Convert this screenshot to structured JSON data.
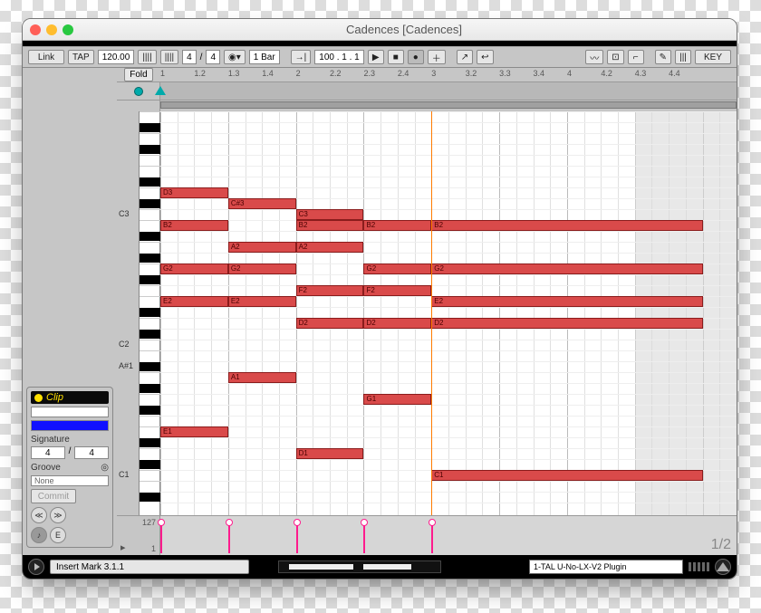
{
  "window": {
    "title": "Cadences  [Cadences]"
  },
  "toolbar": {
    "link": "Link",
    "tap": "TAP",
    "tempo": "120.00",
    "sig_num": "4",
    "sig_den": "4",
    "quantize": "1 Bar",
    "position": "100 .  1 .  1",
    "key": "KEY"
  },
  "timeline": {
    "fold": "Fold",
    "ticks": [
      "1",
      "1.2",
      "1.3",
      "1.4",
      "2",
      "2.2",
      "2.3",
      "2.4",
      "3",
      "3.2",
      "3.3",
      "3.4",
      "4",
      "4.2",
      "4.3",
      "4.4"
    ]
  },
  "clip_panel": {
    "header": "Clip",
    "signature_label": "Signature",
    "sig_num": "4",
    "sig_den": "4",
    "groove_label": "Groove",
    "groove_value": "None",
    "commit": "Commit"
  },
  "key_labels": [
    {
      "name": "C3",
      "row": 9
    },
    {
      "name": "C2",
      "row": 21
    },
    {
      "name": "A#1",
      "row": 23
    },
    {
      "name": "C1",
      "row": 33
    }
  ],
  "notes": [
    {
      "label": "D3",
      "row": 7,
      "start": 0,
      "len": 4
    },
    {
      "label": "C#3",
      "row": 8,
      "start": 4,
      "len": 4
    },
    {
      "label": "C3",
      "row": 9,
      "start": 8,
      "len": 4
    },
    {
      "label": "B2",
      "row": 10,
      "start": 0,
      "len": 4
    },
    {
      "label": "B2",
      "row": 10,
      "start": 8,
      "len": 4
    },
    {
      "label": "B2",
      "row": 10,
      "start": 12,
      "len": 4
    },
    {
      "label": "B2",
      "row": 10,
      "start": 16,
      "len": 16
    },
    {
      "label": "A2",
      "row": 12,
      "start": 4,
      "len": 4
    },
    {
      "label": "A2",
      "row": 12,
      "start": 8,
      "len": 4
    },
    {
      "label": "G2",
      "row": 14,
      "start": 0,
      "len": 4
    },
    {
      "label": "G2",
      "row": 14,
      "start": 4,
      "len": 4
    },
    {
      "label": "G2",
      "row": 14,
      "start": 12,
      "len": 4
    },
    {
      "label": "G2",
      "row": 14,
      "start": 16,
      "len": 16
    },
    {
      "label": "F2",
      "row": 16,
      "start": 8,
      "len": 4
    },
    {
      "label": "F2",
      "row": 16,
      "start": 12,
      "len": 4
    },
    {
      "label": "E2",
      "row": 17,
      "start": 0,
      "len": 4
    },
    {
      "label": "E2",
      "row": 17,
      "start": 4,
      "len": 4
    },
    {
      "label": "E2",
      "row": 17,
      "start": 16,
      "len": 16
    },
    {
      "label": "D2",
      "row": 19,
      "start": 8,
      "len": 4
    },
    {
      "label": "D2",
      "row": 19,
      "start": 12,
      "len": 4
    },
    {
      "label": "D2",
      "row": 19,
      "start": 16,
      "len": 16
    },
    {
      "label": "A1",
      "row": 24,
      "start": 4,
      "len": 4
    },
    {
      "label": "G1",
      "row": 26,
      "start": 12,
      "len": 4
    },
    {
      "label": "E1",
      "row": 29,
      "start": 0,
      "len": 4
    },
    {
      "label": "D1",
      "row": 31,
      "start": 8,
      "len": 4
    },
    {
      "label": "C1",
      "row": 33,
      "start": 16,
      "len": 16
    }
  ],
  "velocity": {
    "max": "127",
    "min": "1",
    "stems": [
      0,
      4,
      8,
      12,
      16
    ],
    "page": "1/2"
  },
  "bottom": {
    "insert": "Insert Mark 3.1.1",
    "plugin": "1-TAL U-No-LX-V2 Plugin"
  },
  "grid": {
    "beats": 34,
    "rows": 36,
    "playhead_beat": 16,
    "shade_from": 28
  }
}
